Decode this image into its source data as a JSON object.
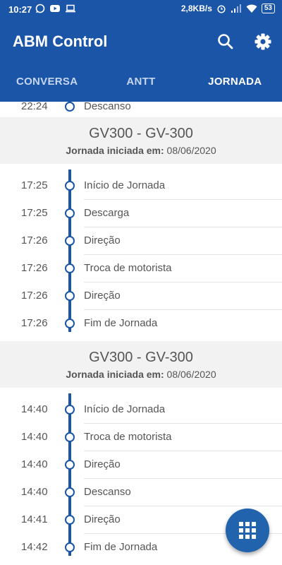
{
  "status_bar": {
    "time": "10:27",
    "speed": "2,8KB/s",
    "battery": "53",
    "icons": [
      "whatsapp-icon",
      "youtube-icon",
      "laptop-icon",
      "alarm-icon",
      "signal-icon",
      "wifi-icon",
      "battery-icon"
    ]
  },
  "app": {
    "title": "ABM Control"
  },
  "tabs": [
    "CONVERSA",
    "ANTT",
    "JORNADA"
  ],
  "active_tab": "JORNADA",
  "partial_row": {
    "time": "22:24",
    "label": "Descanso"
  },
  "sections": [
    {
      "title": "GV300 - GV-300",
      "subtitle_label": "Jornada iniciada em:",
      "subtitle_value": "08/06/2020",
      "events": [
        {
          "time": "17:25",
          "label": "Início de Jornada"
        },
        {
          "time": "17:25",
          "label": "Descarga"
        },
        {
          "time": "17:26",
          "label": "Direção"
        },
        {
          "time": "17:26",
          "label": "Troca de motorista"
        },
        {
          "time": "17:26",
          "label": "Direção"
        },
        {
          "time": "17:26",
          "label": "Fim de Jornada"
        }
      ]
    },
    {
      "title": "GV300 - GV-300",
      "subtitle_label": "Jornada iniciada em:",
      "subtitle_value": "08/06/2020",
      "events": [
        {
          "time": "14:40",
          "label": "Início de Jornada"
        },
        {
          "time": "14:40",
          "label": "Troca de motorista"
        },
        {
          "time": "14:40",
          "label": "Direção"
        },
        {
          "time": "14:40",
          "label": "Descanso"
        },
        {
          "time": "14:41",
          "label": "Direção"
        },
        {
          "time": "14:42",
          "label": "Fim de Jornada"
        }
      ]
    }
  ],
  "colors": {
    "primary": "#1b55a8",
    "header_bg": "#f2f2f2",
    "fab": "#2163ac"
  },
  "fab_icon": "grid-icon"
}
